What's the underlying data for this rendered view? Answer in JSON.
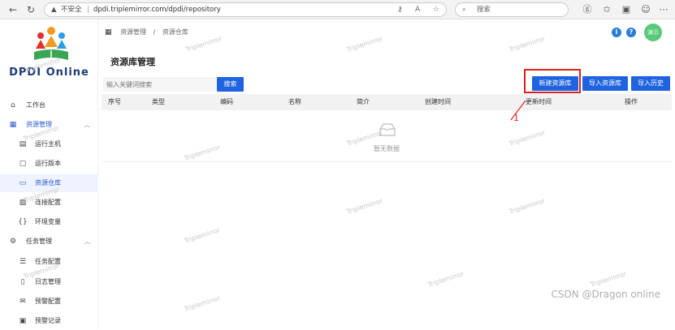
{
  "browser": {
    "insecure_label": "不安全",
    "url": "dpdi.triplemirror.com/dpdi/repository",
    "search_placeholder": "搜索"
  },
  "sidebar": {
    "logo_text": "DPDI  Online",
    "items": [
      {
        "label": "工作台",
        "icon": "home-icon"
      },
      {
        "label": "资源管理",
        "icon": "grid-icon"
      },
      {
        "label": "运行主机",
        "icon": "server-icon"
      },
      {
        "label": "运行版本",
        "icon": "version-icon"
      },
      {
        "label": "资源仓库",
        "icon": "repository-icon"
      },
      {
        "label": "连接配置",
        "icon": "connection-icon"
      },
      {
        "label": "环境变量",
        "icon": "braces-icon"
      },
      {
        "label": "任务管理",
        "icon": "gear-icon"
      },
      {
        "label": "任务配置",
        "icon": "list-icon"
      },
      {
        "label": "日志管理",
        "icon": "log-icon"
      },
      {
        "label": "预警配置",
        "icon": "mail-icon"
      },
      {
        "label": "预警记录",
        "icon": "record-icon"
      }
    ]
  },
  "breadcrumb": {
    "level1": "资源管理",
    "separator": "/",
    "level2": "资源仓库"
  },
  "header": {
    "info": "i",
    "help": "?",
    "avatar": "演示"
  },
  "page": {
    "title": "资源库管理",
    "search_placeholder": "输入关键词搜索",
    "search_button": "搜索",
    "new_button": "新建资源库",
    "import_button": "导入资源库",
    "history_button": "导入历史"
  },
  "table": {
    "columns": [
      "序号",
      "类型",
      "编码",
      "名称",
      "简介",
      "创建时间",
      "更新时间",
      "操作"
    ],
    "empty_text": "暂无数据"
  },
  "annotation": {
    "number": "1",
    "color": "#e02020"
  },
  "watermark": "Triplemirror",
  "credit": "CSDN @Dragon online",
  "colors": {
    "primary": "#1f63e0",
    "brand": "#1b3b7a"
  }
}
